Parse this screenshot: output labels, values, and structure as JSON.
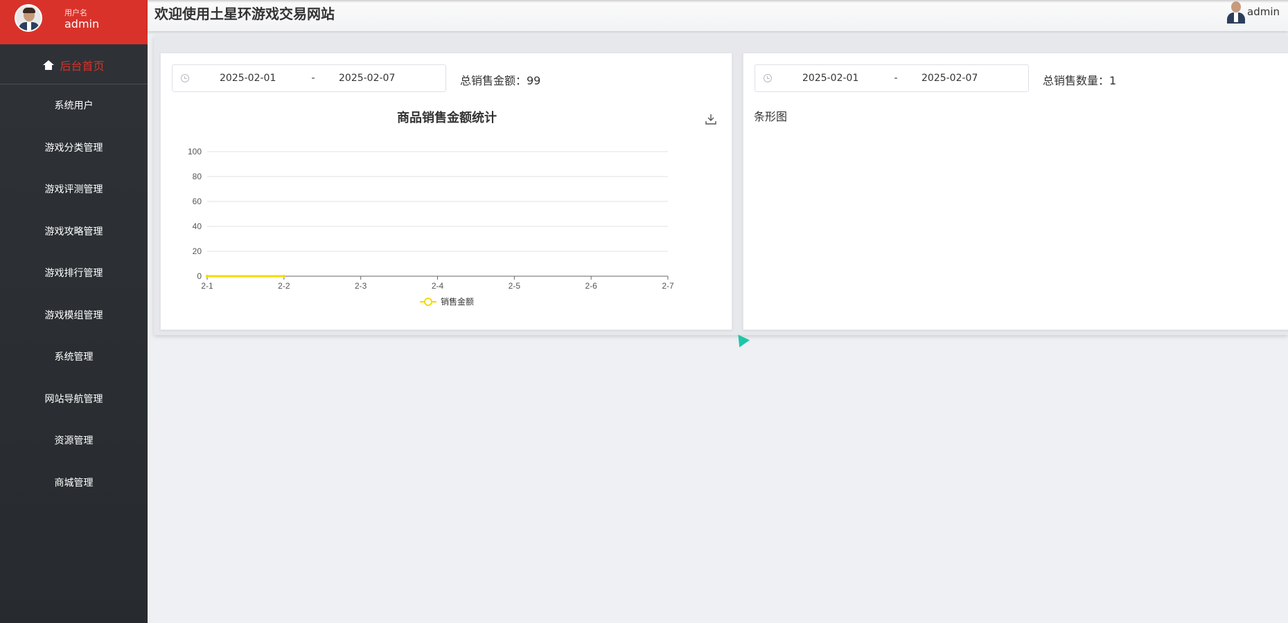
{
  "sidebar": {
    "user_label": "用户名",
    "user_name": "admin",
    "home_label": "后台首页",
    "items": [
      {
        "label": "系统用户"
      },
      {
        "label": "游戏分类管理"
      },
      {
        "label": "游戏评测管理"
      },
      {
        "label": "游戏攻略管理"
      },
      {
        "label": "游戏排行管理"
      },
      {
        "label": "游戏模组管理"
      },
      {
        "label": "系统管理"
      },
      {
        "label": "网站导航管理"
      },
      {
        "label": "资源管理"
      },
      {
        "label": "商城管理"
      }
    ]
  },
  "header": {
    "title": "欢迎使用土星环游戏交易网站",
    "user": "admin"
  },
  "left_card": {
    "date_start": "2025-02-01",
    "date_sep": "-",
    "date_end": "2025-02-07",
    "total_text": "总销售金额：99"
  },
  "right_card": {
    "date_start": "2025-02-01",
    "date_sep": "-",
    "date_end": "2025-02-07",
    "total_text": "总销售数量：1",
    "chart_title": "条形图"
  },
  "colors": {
    "accent": "#d9322b",
    "sidebar": "#2b2f33",
    "series": "#f5d90a"
  },
  "chart_data": {
    "type": "line",
    "title": "商品销售金额统计",
    "categories": [
      "2-1",
      "2-2",
      "2-3",
      "2-4",
      "2-5",
      "2-6",
      "2-7"
    ],
    "series": [
      {
        "name": "销售金额",
        "values": [
          0,
          0,
          null,
          null,
          null,
          null,
          null
        ]
      }
    ],
    "yticks": [
      "0",
      "20",
      "40",
      "60",
      "80",
      "100"
    ],
    "ylim": [
      0,
      100
    ],
    "grid": true,
    "legend": "bottom"
  }
}
